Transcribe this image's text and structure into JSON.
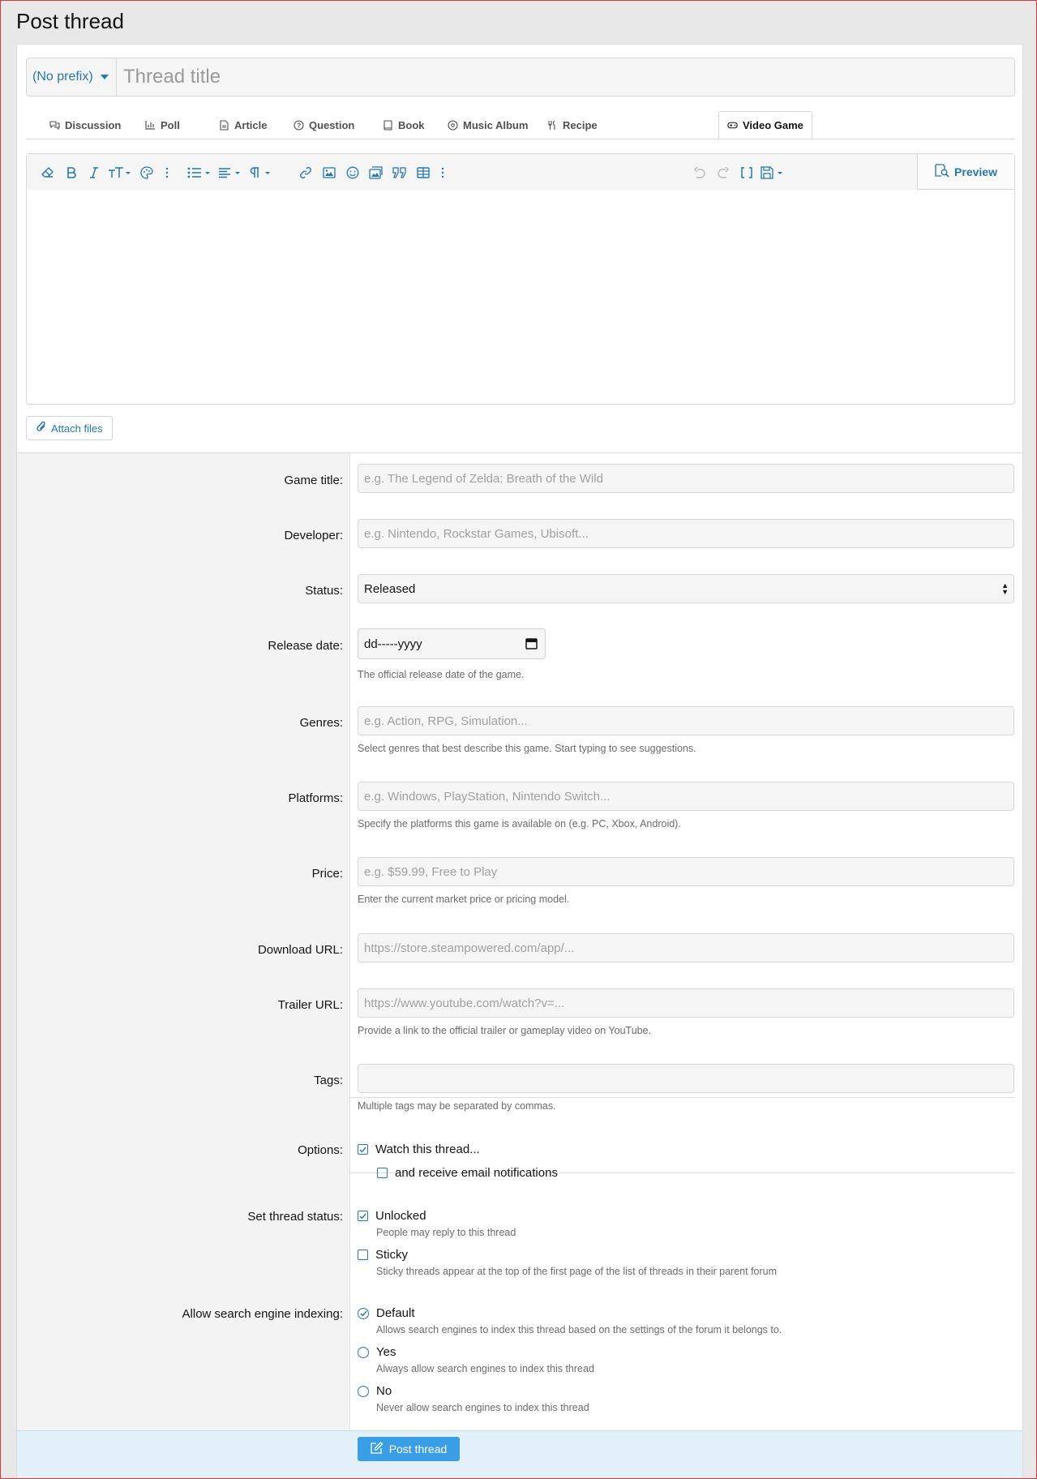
{
  "page": {
    "title": "Post thread"
  },
  "title_row": {
    "prefix": "(No prefix)",
    "title_placeholder": "Thread title"
  },
  "tabs": [
    {
      "label": "Discussion",
      "icon": "chat-bubbles-icon"
    },
    {
      "label": "Poll",
      "icon": "bar-chart-icon"
    },
    {
      "label": "Article",
      "icon": "document-icon"
    },
    {
      "label": "Question",
      "icon": "question-circle-icon"
    },
    {
      "label": "Book",
      "icon": "book-icon"
    },
    {
      "label": "Music Album",
      "icon": "disc-icon"
    },
    {
      "label": "Recipe",
      "icon": "utensils-icon"
    },
    {
      "label": "Video Game",
      "icon": "gamepad-icon",
      "active": true
    }
  ],
  "editor": {
    "preview_label": "Preview",
    "toolbar_icons": [
      "eraser-icon",
      "bold-icon",
      "italic-icon",
      "text-size-icon",
      "palette-icon",
      "more-vertical-icon",
      "list-icon",
      "align-icon",
      "paragraph-icon",
      "link-icon",
      "image-icon",
      "emoji-icon",
      "media-icon",
      "quote-icon",
      "table-icon",
      "more-vertical-icon",
      "undo-icon",
      "redo-icon",
      "bbcode-icon",
      "drafts-icon",
      "preview-icon"
    ]
  },
  "attach": {
    "label": "Attach files"
  },
  "fields": {
    "game_title": {
      "label": "Game title:",
      "placeholder": "e.g. The Legend of Zelda: Breath of the Wild"
    },
    "developer": {
      "label": "Developer:",
      "placeholder": "e.g. Nintendo, Rockstar Games, Ubisoft..."
    },
    "status": {
      "label": "Status:",
      "value": "Released"
    },
    "release_date": {
      "label": "Release date:",
      "value": "dd-----yyyy",
      "hint": "The official release date of the game."
    },
    "genres": {
      "label": "Genres:",
      "placeholder": "e.g. Action, RPG, Simulation...",
      "hint": "Select genres that best describe this game. Start typing to see suggestions."
    },
    "platforms": {
      "label": "Platforms:",
      "placeholder": "e.g. Windows, PlayStation, Nintendo Switch...",
      "hint": "Specify the platforms this game is available on (e.g. PC, Xbox, Android)."
    },
    "price": {
      "label": "Price:",
      "placeholder": "e.g. $59.99, Free to Play",
      "hint": "Enter the current market price or pricing model."
    },
    "download_url": {
      "label": "Download URL:",
      "placeholder": "https://store.steampowered.com/app/..."
    },
    "trailer_url": {
      "label": "Trailer URL:",
      "placeholder": "https://www.youtube.com/watch?v=...",
      "hint": "Provide a link to the official trailer or gameplay video on YouTube."
    },
    "tags": {
      "label": "Tags:",
      "placeholder": "",
      "hint": "Multiple tags may be separated by commas."
    }
  },
  "options": {
    "label": "Options:",
    "watch": {
      "label": "Watch this thread...",
      "checked": true
    },
    "email": {
      "label": "and receive email notifications",
      "checked": false
    }
  },
  "thread_status": {
    "label": "Set thread status:",
    "unlocked": {
      "label": "Unlocked",
      "desc": "People may reply to this thread",
      "checked": true
    },
    "sticky": {
      "label": "Sticky",
      "desc": "Sticky threads appear at the top of the first page of the list of threads in their parent forum",
      "checked": false
    }
  },
  "indexing": {
    "label": "Allow search engine indexing:",
    "default": {
      "label": "Default",
      "desc": "Allows search engines to index this thread based on the settings of the forum it belongs to.",
      "selected": true
    },
    "yes": {
      "label": "Yes",
      "desc": "Always allow search engines to index this thread",
      "selected": false
    },
    "no": {
      "label": "No",
      "desc": "Never allow search engines to index this thread",
      "selected": false
    }
  },
  "footer": {
    "submit_label": "Post thread"
  },
  "colors": {
    "accent": "#2577b1",
    "button": "#3a9ee6",
    "footer_bg": "#e2f0fa"
  }
}
